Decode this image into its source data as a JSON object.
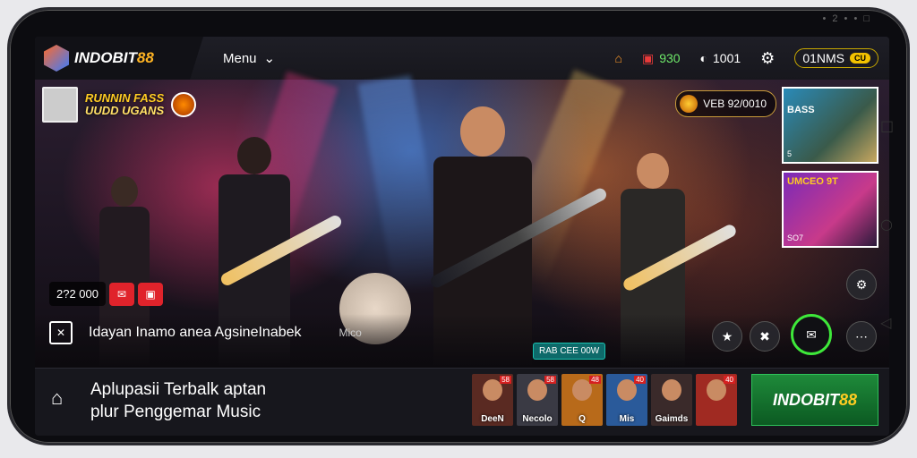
{
  "status_bar": {
    "text": "• 2 • • □"
  },
  "brand": {
    "name_a": "INDOBIT",
    "name_b": "88"
  },
  "menu": {
    "label": "Menu"
  },
  "top_right": {
    "home_icon": "home-icon",
    "item1": "&lt;",
    "coins": "930",
    "users": "1001",
    "settings_icon": "gear-icon",
    "balance": "01NMS",
    "balance_tag": "CU"
  },
  "hero": {
    "artist_title_line1": "RUNNIN FASS",
    "artist_title_line2": "UUDD UGANS",
    "live_pill": "VEB 92/0010",
    "price": "2?2 000",
    "now_playing": "Idayan Inamo anea AgsineInabek",
    "now_playing_extra": "Mico",
    "badge": "RAB CEE 00W",
    "side_cards": [
      {
        "title": "BASS",
        "sub": "5"
      },
      {
        "title": "UMCEO 9T",
        "sub": "SO7"
      }
    ]
  },
  "bottom": {
    "title_line1": "Aplupasii Terbalk aptan",
    "title_line2": "plur Penggemar Music",
    "thumbs": [
      {
        "caption": "DeeN",
        "tag": "58",
        "color": "#5a2a22"
      },
      {
        "caption": "Necolo",
        "tag": "58",
        "color": "#3a3a44"
      },
      {
        "caption": "Q",
        "tag": "48",
        "color": "#b86a1a"
      },
      {
        "caption": "Mis",
        "tag": "40",
        "color": "#2a5a9a"
      },
      {
        "caption": "Gaimds",
        "tag": "",
        "color": "#3a2a2a"
      },
      {
        "caption": "",
        "tag": "40",
        "color": "#a02a22"
      }
    ],
    "cta_a": "INDOBIT",
    "cta_b": "88"
  },
  "colors": {
    "accent": "#ffb423",
    "live": "#e0232b",
    "cta": "#1e8a3a",
    "ring": "#3ee83a"
  }
}
